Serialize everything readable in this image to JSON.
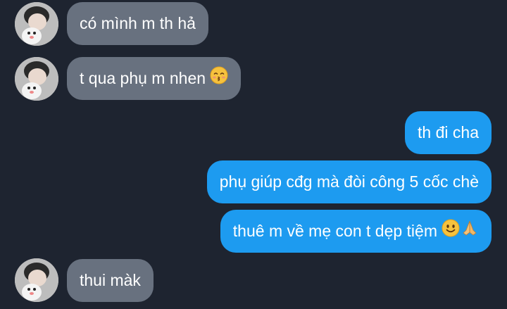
{
  "messages": [
    {
      "direction": "incoming",
      "text": "có mình m th hả",
      "emoji": []
    },
    {
      "direction": "incoming",
      "text": "t qua phụ m nhen",
      "emoji": [
        "kissing-face-emoji"
      ]
    },
    {
      "direction": "outgoing",
      "text": "th đi cha",
      "emoji": []
    },
    {
      "direction": "outgoing",
      "text": "phụ giúp cđg mà đòi công 5 cốc chè",
      "emoji": []
    },
    {
      "direction": "outgoing",
      "text": "thuê m về mẹ con t dẹp tiệm",
      "emoji": [
        "slightly-smiling-face-emoji",
        "folded-hands-emoji"
      ]
    },
    {
      "direction": "incoming",
      "text": "thui màk",
      "emoji": []
    }
  ],
  "colors": {
    "background": "#1e2430",
    "incoming_bubble": "#68717f",
    "outgoing_bubble": "#1d9bf0",
    "text": "#ffffff"
  }
}
